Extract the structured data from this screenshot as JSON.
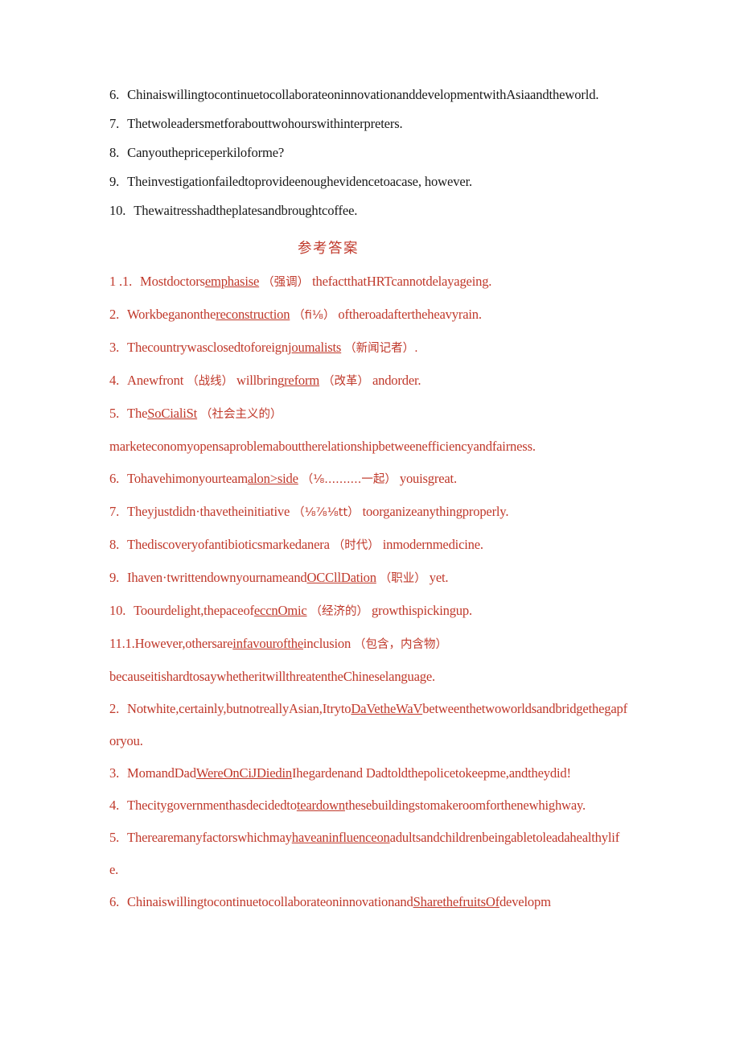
{
  "document": {
    "questions_section": {
      "lines": [
        {
          "num": "6.",
          "text": "ChinaiswillingtocontinuetocollaborateoninnovationanddevelopmentwithAsiaandtheworld."
        },
        {
          "num": "7.",
          "text": "Thetwoleadersmetforabouttwohourswithinterpreters."
        },
        {
          "num": "8.",
          "text": "Canyouthepriceperkiloforme?"
        },
        {
          "num": "9.",
          "text": "Theinvestigationfailedtoprovideenoughevidencetoacase, however."
        },
        {
          "num": "10.",
          "text": "Thewaitresshadtheplatesandbroughtcoffee."
        }
      ]
    },
    "answers_heading": "参考答案",
    "answers_section_1": {
      "lines": [
        {
          "num": "1 .1.",
          "parts": [
            {
              "t": "Mostdoctors"
            },
            {
              "t": "emphasise",
              "u": true
            },
            {
              "t": "（强调）",
              "cn": true
            },
            {
              "t": "thefactthatHRTcannotdelayageing."
            }
          ]
        },
        {
          "num": "2.",
          "parts": [
            {
              "t": "Workbeganonthe"
            },
            {
              "t": "reconstruction",
              "u": true
            },
            {
              "t": "（fi⅛）",
              "cn": true
            },
            {
              "t": "oftheroadaftertheheavyrain."
            }
          ]
        },
        {
          "num": "3.",
          "parts": [
            {
              "t": "Thecountrywasclosedtoforeign"
            },
            {
              "t": "joumalists",
              "u": true
            },
            {
              "t": "（新闻记者）.",
              "cn": true
            }
          ]
        },
        {
          "num": "4.",
          "parts": [
            {
              "t": "Anewfront"
            },
            {
              "t": "（战线）",
              "cn": true
            },
            {
              "t": "willbring"
            },
            {
              "t": "reform",
              "u": true
            },
            {
              "t": "（改革）",
              "cn": true
            },
            {
              "t": "andorder."
            }
          ]
        },
        {
          "num": "5.",
          "parts": [
            {
              "t": "The"
            },
            {
              "t": "SoCialiSt",
              "u": true
            },
            {
              "t": "（社会主义的）",
              "cn": true
            },
            {
              "t": "\nmarketeconomyopensaproblemabouttherelationshipbetweenefficiencyandfairness."
            }
          ]
        },
        {
          "num": "6.",
          "parts": [
            {
              "t": "Tohavehimonyourteam"
            },
            {
              "t": "alon>side",
              "u": true
            },
            {
              "t": "（⅛..........一起）",
              "cn": true
            },
            {
              "t": "youisgreat."
            }
          ]
        },
        {
          "num": "7.",
          "parts": [
            {
              "t": "Theyjustdidn·thavetheinitiative"
            },
            {
              "t": "（⅛⅞⅛tt）",
              "cn": true
            },
            {
              "t": "toorganizeanythingproperly."
            }
          ]
        },
        {
          "num": "8.",
          "parts": [
            {
              "t": "Thediscoveryofantibioticsmarkedanera"
            },
            {
              "t": "（时代）",
              "cn": true
            },
            {
              "t": "inmodernmedicine."
            }
          ]
        },
        {
          "num": "9.",
          "parts": [
            {
              "t": "Ihaven·twrittendownyournameand"
            },
            {
              "t": "OCCllDation",
              "u": true
            },
            {
              "t": "（职业）",
              "cn": true
            },
            {
              "t": "yet."
            }
          ]
        },
        {
          "num": "10.",
          "parts": [
            {
              "t": "Toourdelight,thepaceof"
            },
            {
              "t": "eccnOmic",
              "u": true
            },
            {
              "t": "（经济的）",
              "cn": true
            },
            {
              "t": "growthispickingup."
            }
          ]
        }
      ]
    },
    "answers_section_2": {
      "lines": [
        {
          "num": "11.1.",
          "nogap": true,
          "parts": [
            {
              "t": "However,othersare"
            },
            {
              "t": "infavourofthe",
              "u": true
            },
            {
              "t": "inclusion"
            },
            {
              "t": "（包含，内含物）",
              "cn": true
            },
            {
              "t": "\nbecauseitishardtosaywhetheritwillthreatentheChineselanguage."
            }
          ]
        },
        {
          "num": "2.",
          "parts": [
            {
              "t": "Notwhite,certainly,butnotreallyAsian,Itryto"
            },
            {
              "t": "DaVetheWaV",
              "u": true
            },
            {
              "t": "betweenthetwoworldsandbridgethegapforyou."
            }
          ]
        },
        {
          "num": "3.",
          "parts": [
            {
              "t": "MomandDad"
            },
            {
              "t": "WereOnCiJDiedin",
              "u": true
            },
            {
              "t": "Ihegardenand Dadtoldthepolicetokeepme,andtheydid!"
            }
          ]
        },
        {
          "num": "4.",
          "parts": [
            {
              "t": "Thecitygovernmenthasdecidedto"
            },
            {
              "t": "teardown",
              "u": true
            },
            {
              "t": "thesebuildingstomakeroomforthenewhighway."
            }
          ]
        },
        {
          "num": "5.",
          "parts": [
            {
              "t": "Therearemanyfactorswhichmay"
            },
            {
              "t": "haveaninfluenceon",
              "u": true
            },
            {
              "t": "adultsandchildrenbeingabletoleadahealthylife."
            }
          ]
        },
        {
          "num": "6.",
          "parts": [
            {
              "t": "Chinaiswillingtocontinuetocollaborateoninnovationand"
            },
            {
              "t": "SharethefruitsOf",
              "u": true
            },
            {
              "t": "developm"
            }
          ]
        }
      ]
    },
    "colors": {
      "answer_red": "#c0392b",
      "question_black": "#1a1a1a",
      "page_background": "#ffffff"
    }
  }
}
